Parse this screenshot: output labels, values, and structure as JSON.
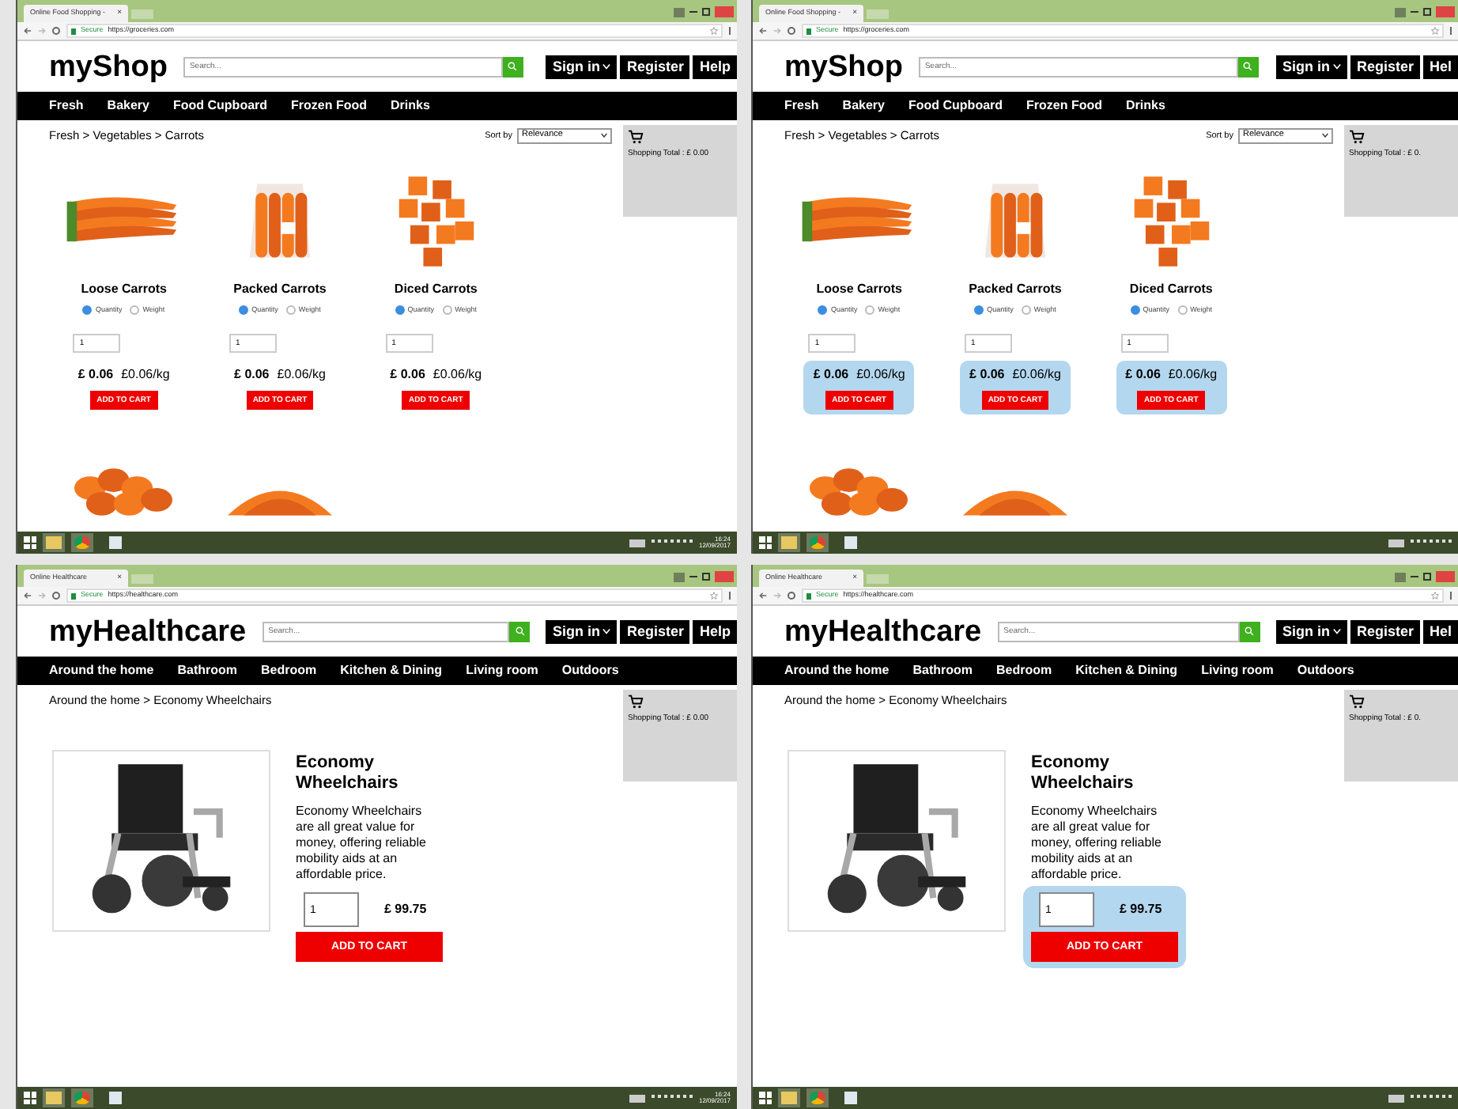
{
  "panels": [
    {
      "tab_title": "Online Food Shopping -",
      "tab_close": "×",
      "secure": "Secure",
      "url": "https://groceries.com",
      "logo": "myShop",
      "search_placeholder": "Search...",
      "header_buttons": [
        {
          "label": "Sign in",
          "dropdown": true
        },
        {
          "label": "Register",
          "dropdown": false
        },
        {
          "label": "Help",
          "dropdown": false
        }
      ],
      "nav": [
        "Fresh",
        "Bakery",
        "Food Cupboard",
        "Frozen Food",
        "Drinks"
      ],
      "breadcrumb": "Fresh > Vegetables > Carrots",
      "sort": {
        "label": "Sort by",
        "value": "Relevance"
      },
      "cart_total": "Shopping Total : £ 0.00",
      "kind": "grid",
      "highlighted": false,
      "products": [
        {
          "kind": "full",
          "name": "Loose Carrots",
          "options": [
            {
              "label": "Quantity",
              "selected": true
            },
            {
              "label": "Weight",
              "selected": false
            }
          ],
          "quantity": "1",
          "price": "£ 0.06",
          "unit_price": "£0.06/kg",
          "button": "ADD TO CART"
        },
        {
          "kind": "full",
          "name": "Packed Carrots",
          "options": [
            {
              "label": "Quantity",
              "selected": true
            },
            {
              "label": "Weight",
              "selected": false
            }
          ],
          "quantity": "1",
          "price": "£ 0.06",
          "unit_price": "£0.06/kg",
          "button": "ADD TO CART"
        },
        {
          "kind": "full",
          "name": "Diced Carrots",
          "options": [
            {
              "label": "Quantity",
              "selected": true
            },
            {
              "label": "Weight",
              "selected": false
            }
          ],
          "quantity": "1",
          "price": "£ 0.06",
          "unit_price": "£0.06/kg",
          "button": "ADD TO CART"
        },
        {
          "kind": "partial"
        },
        {
          "kind": "partial"
        }
      ],
      "clock": {
        "time": "16:24",
        "date": "12/09/2017"
      }
    },
    {
      "tab_title": "Online Food Shopping -",
      "tab_close": "×",
      "secure": "Secure",
      "url": "https://groceries.com",
      "logo": "myShop",
      "search_placeholder": "Search...",
      "header_buttons": [
        {
          "label": "Sign in",
          "dropdown": true
        },
        {
          "label": "Register",
          "dropdown": false
        },
        {
          "label": "Hel",
          "dropdown": false
        }
      ],
      "nav": [
        "Fresh",
        "Bakery",
        "Food Cupboard",
        "Frozen Food",
        "Drinks"
      ],
      "breadcrumb": "Fresh > Vegetables > Carrots",
      "sort": {
        "label": "Sort by",
        "value": "Relevance"
      },
      "cart_total": "Shopping Total : £ 0.",
      "kind": "grid",
      "highlighted": true,
      "products": [
        {
          "kind": "full",
          "name": "Loose Carrots",
          "options": [
            {
              "label": "Quantity",
              "selected": true
            },
            {
              "label": "Weight",
              "selected": false
            }
          ],
          "quantity": "1",
          "price": "£ 0.06",
          "unit_price": "£0.06/kg",
          "button": "ADD TO CART"
        },
        {
          "kind": "full",
          "name": "Packed Carrots",
          "options": [
            {
              "label": "Quantity",
              "selected": true
            },
            {
              "label": "Weight",
              "selected": false
            }
          ],
          "quantity": "1",
          "price": "£ 0.06",
          "unit_price": "£0.06/kg",
          "button": "ADD TO CART"
        },
        {
          "kind": "full",
          "name": "Diced Carrots",
          "options": [
            {
              "label": "Quantity",
              "selected": true
            },
            {
              "label": "Weight",
              "selected": false
            }
          ],
          "quantity": "1",
          "price": "£ 0.06",
          "unit_price": "£0.06/kg",
          "button": "ADD TO CART"
        },
        {
          "kind": "partial"
        },
        {
          "kind": "partial"
        }
      ]
    },
    {
      "tab_title": "Online Healthcare",
      "tab_close": "×",
      "secure": "Secure",
      "url": "https://healthcare.com",
      "logo": "myHealthcare",
      "search_placeholder": "Search...",
      "header_buttons": [
        {
          "label": "Sign in",
          "dropdown": true
        },
        {
          "label": "Register",
          "dropdown": false
        },
        {
          "label": "Help",
          "dropdown": false
        }
      ],
      "nav": [
        "Around the home",
        "Bathroom",
        "Bedroom",
        "Kitchen & Dining",
        "Living room",
        "Outdoors"
      ],
      "breadcrumb": "Around the home > Economy Wheelchairs",
      "cart_total": "Shopping Total : £ 0.00",
      "kind": "detail",
      "highlighted": false,
      "product": {
        "name": "Economy Wheelchairs",
        "description": "Economy Wheelchairs are all great value for money, offering reliable mobility aids at an affordable price.",
        "quantity": "1",
        "price": "£ 99.75",
        "button": "ADD TO CART"
      },
      "clock": {
        "time": "16:24",
        "date": "12/09/2017"
      }
    },
    {
      "tab_title": "Online Healthcare",
      "tab_close": "×",
      "secure": "Secure",
      "url": "https://healthcare.com",
      "logo": "myHealthcare",
      "search_placeholder": "Search...",
      "header_buttons": [
        {
          "label": "Sign in",
          "dropdown": true
        },
        {
          "label": "Register",
          "dropdown": false
        },
        {
          "label": "Hel",
          "dropdown": false
        }
      ],
      "nav": [
        "Around the home",
        "Bathroom",
        "Bedroom",
        "Kitchen & Dining",
        "Living room",
        "Outdoors"
      ],
      "breadcrumb": "Around the home > Economy Wheelchairs",
      "cart_total": "Shopping Total : £ 0.",
      "kind": "detail",
      "highlighted": true,
      "product": {
        "name": "Economy Wheelchairs",
        "description": "Economy Wheelchairs are all great value for money, offering reliable mobility aids at an affordable price.",
        "quantity": "1",
        "price": "£ 99.75",
        "button": "ADD TO CART"
      }
    }
  ]
}
